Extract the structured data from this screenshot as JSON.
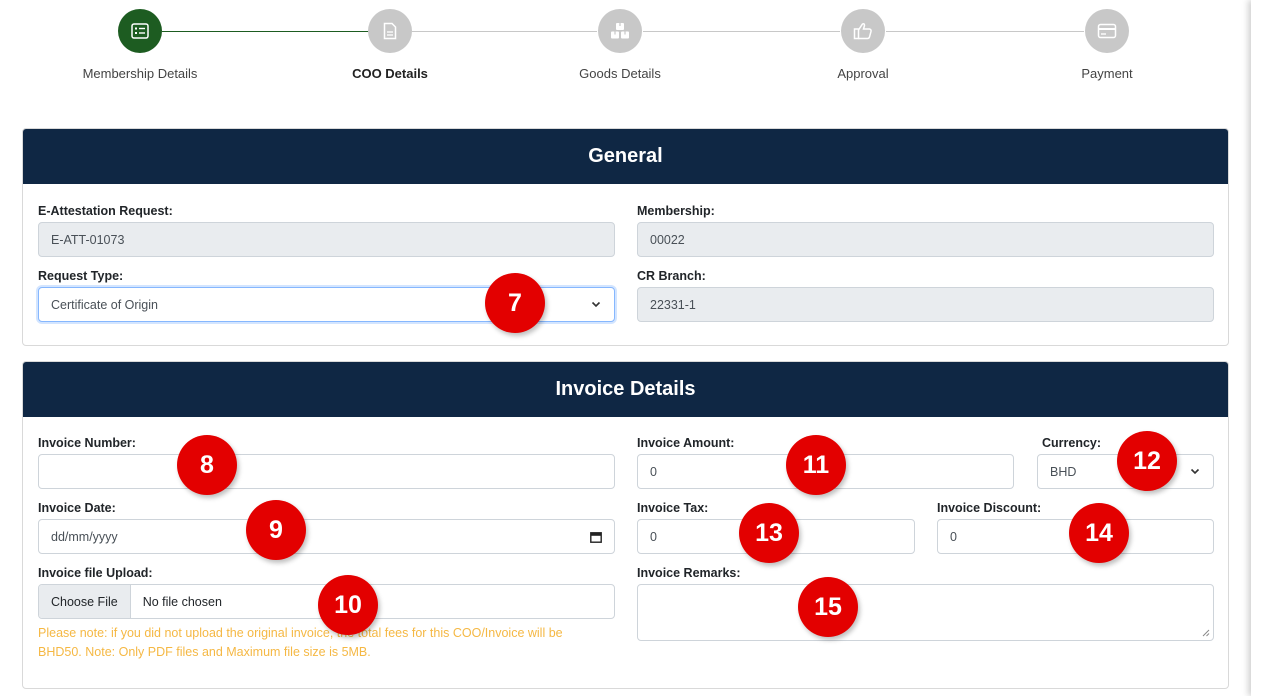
{
  "stepper": {
    "steps": [
      {
        "label": "Membership Details",
        "icon": "id-card-icon",
        "active": true
      },
      {
        "label": "COO Details",
        "icon": "document-icon",
        "active": false
      },
      {
        "label": "Goods Details",
        "icon": "boxes-icon",
        "active": false
      },
      {
        "label": "Approval",
        "icon": "thumbs-up-icon",
        "active": false
      },
      {
        "label": "Payment",
        "icon": "credit-card-icon",
        "active": false
      }
    ]
  },
  "general": {
    "title": "General",
    "e_attestation_label": "E-Attestation Request:",
    "e_attestation_value": "E-ATT-01073",
    "membership_label": "Membership:",
    "membership_value": "00022",
    "request_type_label": "Request Type:",
    "request_type_value": "Certificate of Origin",
    "cr_branch_label": "CR Branch:",
    "cr_branch_value": "22331-1"
  },
  "invoice": {
    "title": "Invoice Details",
    "number_label": "Invoice Number:",
    "number_value": "",
    "amount_label": "Invoice Amount:",
    "amount_value": "0",
    "currency_label": "Currency:",
    "currency_value": "BHD",
    "date_label": "Invoice Date:",
    "date_placeholder": "dd/mm/yyyy",
    "tax_label": "Invoice Tax:",
    "tax_value": "0",
    "discount_label": "Invoice Discount:",
    "discount_value": "0",
    "upload_label": "Invoice file Upload:",
    "choose_file": "Choose File",
    "no_file": "No file chosen",
    "note": "Please note: if you did not upload the original invoice, the total fees for this COO/Invoice will be BHD50. Note: Only PDF files and Maximum file size is 5MB.",
    "remarks_label": "Invoice Remarks:",
    "remarks_value": ""
  },
  "callouts": [
    "7",
    "8",
    "9",
    "10",
    "11",
    "12",
    "13",
    "14",
    "15"
  ],
  "colors": {
    "header_bg": "#0f2744",
    "step_active": "#1d5c21",
    "step_inactive": "#c8c8c8",
    "note_text": "#f5b844",
    "callout": "#e30000"
  }
}
